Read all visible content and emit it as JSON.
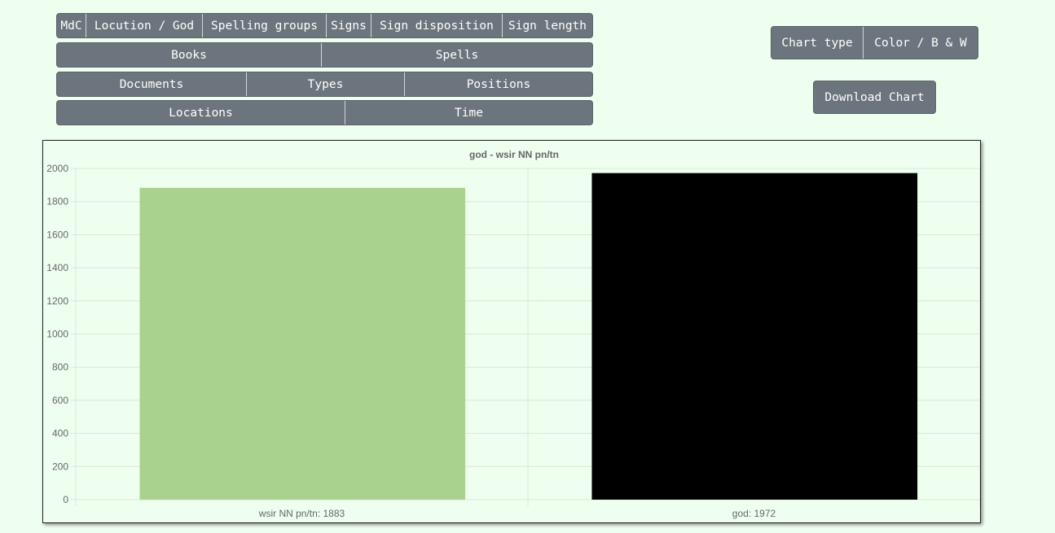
{
  "toolbar": {
    "row1": [
      "MdC",
      "Locution / God",
      "Spelling groups",
      "Signs",
      "Sign disposition",
      "Sign length"
    ],
    "row2": [
      "Books",
      "Spells"
    ],
    "row3": [
      "Documents",
      "Types",
      "Positions"
    ],
    "row4": [
      "Locations",
      "Time"
    ]
  },
  "chart_options": {
    "chart_type_label": "Chart type",
    "color_label": "Color / B & W",
    "download_label": "Download Chart"
  },
  "chart_data": {
    "type": "bar",
    "title": "god - wsir NN pn/tn",
    "categories": [
      "wsir NN pn/tn: 1883",
      "god: 1972"
    ],
    "values": [
      1883,
      1972
    ],
    "colors": [
      "#a8d28e",
      "#000000"
    ],
    "ylim": [
      0,
      2000
    ],
    "yticks": [
      0,
      200,
      400,
      600,
      800,
      1000,
      1200,
      1400,
      1600,
      1800,
      2000
    ],
    "grid": true,
    "xlabel": "",
    "ylabel": ""
  }
}
